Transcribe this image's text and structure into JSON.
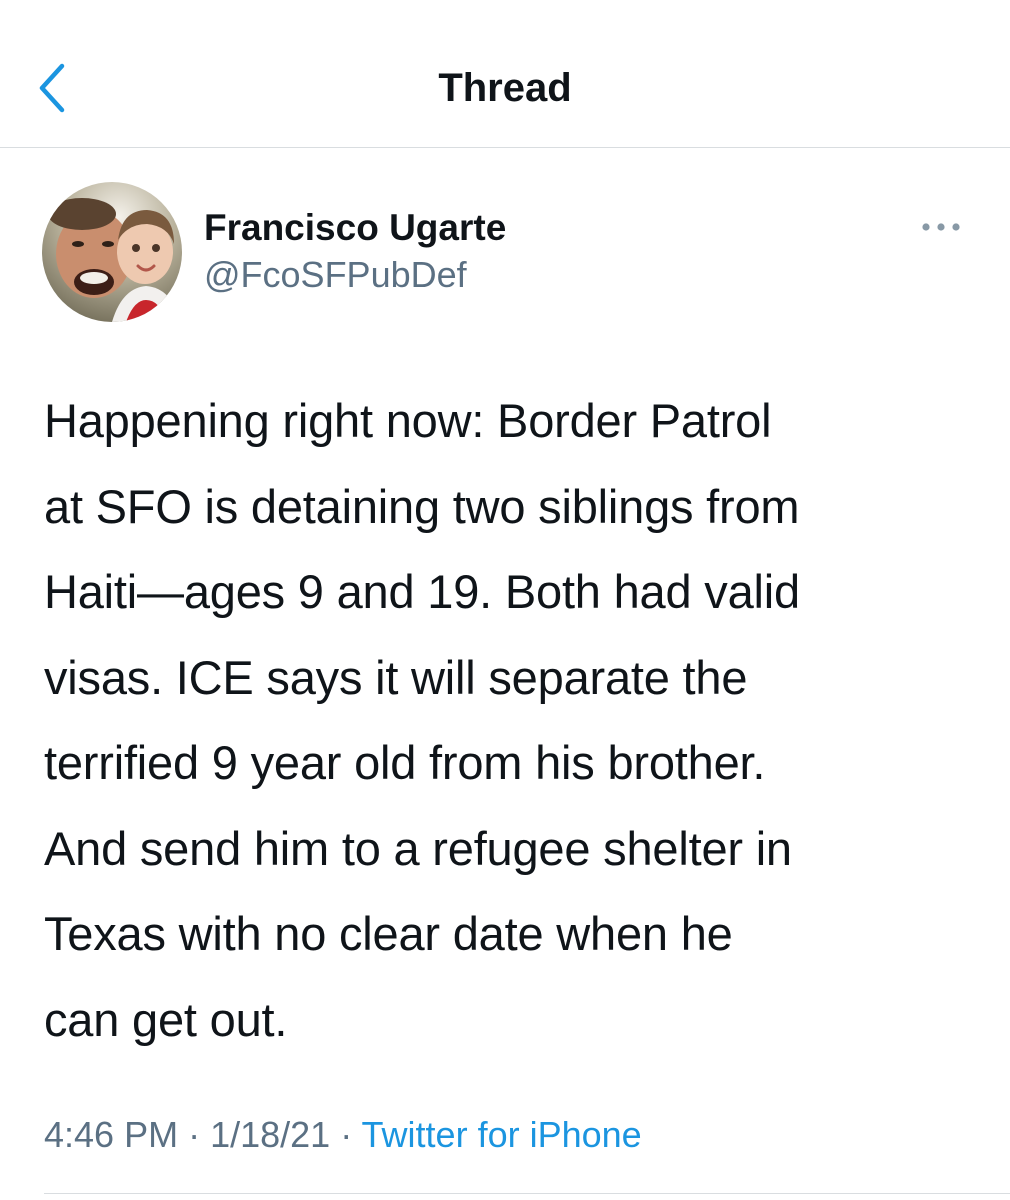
{
  "header": {
    "title": "Thread",
    "back_icon": "chevron-left-icon"
  },
  "tweet": {
    "author": {
      "name": "Francisco Ugarte",
      "handle": "@FcoSFPubDef",
      "avatar_icon": "avatar-photo"
    },
    "more_icon": "ellipsis-icon",
    "text": "Happening right now: Border Patrol\nat SFO is detaining two siblings from\nHaiti—ages 9 and 19. Both had valid\nvisas. ICE says it will separate the\nterrified 9 year old from his brother.\nAnd send him to a refugee shelter in\nTexas with no clear date when he\ncan get out.",
    "time": "4:46 PM",
    "separator": " · ",
    "date": "1/18/21",
    "source": "Twitter for iPhone"
  },
  "colors": {
    "accent": "#1b95e0",
    "secondary_text": "#5b7083",
    "divider": "#d9dde0"
  }
}
